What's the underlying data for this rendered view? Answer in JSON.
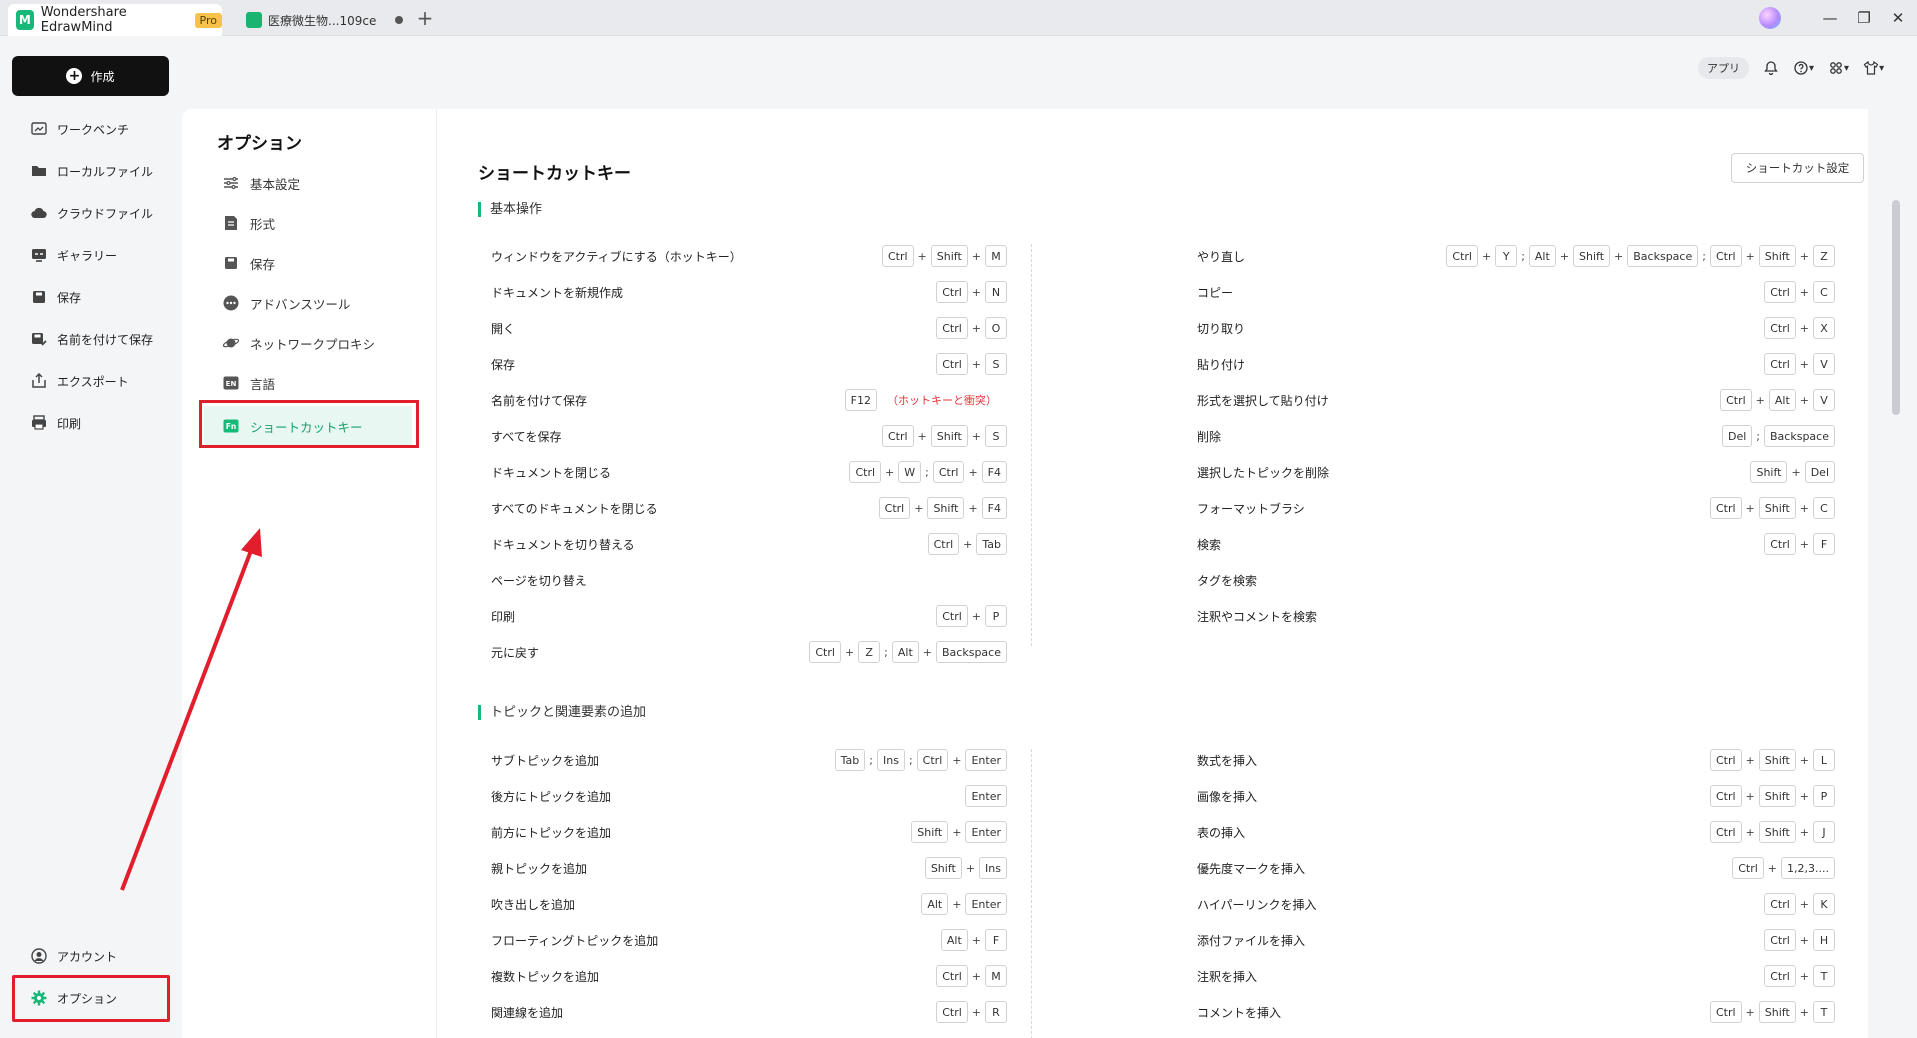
{
  "titlebar": {
    "app_name": "Wondershare EdrawMind",
    "pro_badge": "Pro",
    "doc_tab": "医療微生物...109ce",
    "new_tab": "+",
    "minimize": "—",
    "restore": "❐",
    "close": "✕"
  },
  "toolbar": {
    "apps": "アプリ"
  },
  "sidebar": {
    "create": "作成",
    "items": [
      "ワークベンチ",
      "ローカルファイル",
      "クラウドファイル",
      "ギャラリー",
      "保存",
      "名前を付けて保存",
      "エクスポート",
      "印刷"
    ],
    "account": "アカウント",
    "options": "オプション"
  },
  "options_nav": {
    "title": "オプション",
    "items": [
      "基本設定",
      "形式",
      "保存",
      "アドバンスツール",
      "ネットワークプロキシ",
      "言語",
      "ショートカットキー"
    ]
  },
  "main": {
    "title": "ショートカットキー",
    "settings_button": "ショートカット設定",
    "section1": {
      "title": "基本操作",
      "left": [
        {
          "label": "ウィンドウをアクティブにする（ホットキー）",
          "keys": [
            [
              "Ctrl",
              "Shift",
              "M"
            ]
          ]
        },
        {
          "label": "ドキュメントを新規作成",
          "keys": [
            [
              "Ctrl",
              "N"
            ]
          ]
        },
        {
          "label": "開く",
          "keys": [
            [
              "Ctrl",
              "O"
            ]
          ]
        },
        {
          "label": "保存",
          "keys": [
            [
              "Ctrl",
              "S"
            ]
          ]
        },
        {
          "label": "名前を付けて保存",
          "keys": [
            [
              "F12"
            ]
          ],
          "note": "（ホットキーと衝突）"
        },
        {
          "label": "すべてを保存",
          "keys": [
            [
              "Ctrl",
              "Shift",
              "S"
            ]
          ]
        },
        {
          "label": "ドキュメントを閉じる",
          "keys": [
            [
              "Ctrl",
              "W"
            ],
            [
              "Ctrl",
              "F4"
            ]
          ]
        },
        {
          "label": "すべてのドキュメントを閉じる",
          "keys": [
            [
              "Ctrl",
              "Shift",
              "F4"
            ]
          ]
        },
        {
          "label": "ドキュメントを切り替える",
          "keys": [
            [
              "Ctrl",
              "Tab"
            ]
          ]
        },
        {
          "label": "ページを切り替え",
          "keys": []
        },
        {
          "label": "印刷",
          "keys": [
            [
              "Ctrl",
              "P"
            ]
          ]
        },
        {
          "label": "元に戻す",
          "keys": [
            [
              "Ctrl",
              "Z"
            ],
            [
              "Alt",
              "Backspace"
            ]
          ]
        }
      ],
      "right": [
        {
          "label": "やり直し",
          "keys": [
            [
              "Ctrl",
              "Y"
            ],
            [
              "Alt",
              "Shift",
              "Backspace"
            ],
            [
              "Ctrl",
              "Shift",
              "Z"
            ]
          ]
        },
        {
          "label": "コピー",
          "keys": [
            [
              "Ctrl",
              "C"
            ]
          ]
        },
        {
          "label": "切り取り",
          "keys": [
            [
              "Ctrl",
              "X"
            ]
          ]
        },
        {
          "label": "貼り付け",
          "keys": [
            [
              "Ctrl",
              "V"
            ]
          ]
        },
        {
          "label": "形式を選択して貼り付け",
          "keys": [
            [
              "Ctrl",
              "Alt",
              "V"
            ]
          ]
        },
        {
          "label": "削除",
          "keys": [
            [
              "Del"
            ],
            [
              "Backspace"
            ]
          ]
        },
        {
          "label": "選択したトピックを削除",
          "keys": [
            [
              "Shift",
              "Del"
            ]
          ]
        },
        {
          "label": "フォーマットブラシ",
          "keys": [
            [
              "Ctrl",
              "Shift",
              "C"
            ]
          ]
        },
        {
          "label": "検索",
          "keys": [
            [
              "Ctrl",
              "F"
            ]
          ]
        },
        {
          "label": "タグを検索",
          "keys": []
        },
        {
          "label": "注釈やコメントを検索",
          "keys": []
        }
      ]
    },
    "section2": {
      "title": "トピックと関連要素の追加",
      "left": [
        {
          "label": "サブトピックを追加",
          "keys": [
            [
              "Tab"
            ],
            [
              "Ins"
            ],
            [
              "Ctrl",
              "Enter"
            ]
          ]
        },
        {
          "label": "後方にトピックを追加",
          "keys": [
            [
              "Enter"
            ]
          ]
        },
        {
          "label": "前方にトピックを追加",
          "keys": [
            [
              "Shift",
              "Enter"
            ]
          ]
        },
        {
          "label": "親トピックを追加",
          "keys": [
            [
              "Shift",
              "Ins"
            ]
          ]
        },
        {
          "label": "吹き出しを追加",
          "keys": [
            [
              "Alt",
              "Enter"
            ]
          ]
        },
        {
          "label": "フローティングトピックを追加",
          "keys": [
            [
              "Alt",
              "F"
            ]
          ]
        },
        {
          "label": "複数トピックを追加",
          "keys": [
            [
              "Ctrl",
              "M"
            ]
          ]
        },
        {
          "label": "関連線を追加",
          "keys": [
            [
              "Ctrl",
              "R"
            ]
          ]
        }
      ],
      "right": [
        {
          "label": "数式を挿入",
          "keys": [
            [
              "Ctrl",
              "Shift",
              "L"
            ]
          ]
        },
        {
          "label": "画像を挿入",
          "keys": [
            [
              "Ctrl",
              "Shift",
              "P"
            ]
          ]
        },
        {
          "label": "表の挿入",
          "keys": [
            [
              "Ctrl",
              "Shift",
              "J"
            ]
          ]
        },
        {
          "label": "優先度マークを挿入",
          "keys": [
            [
              "Ctrl",
              "1,2,3...."
            ]
          ]
        },
        {
          "label": "ハイパーリンクを挿入",
          "keys": [
            [
              "Ctrl",
              "K"
            ]
          ]
        },
        {
          "label": "添付ファイルを挿入",
          "keys": [
            [
              "Ctrl",
              "H"
            ]
          ]
        },
        {
          "label": "注釈を挿入",
          "keys": [
            [
              "Ctrl",
              "T"
            ]
          ]
        },
        {
          "label": "コメントを挿入",
          "keys": [
            [
              "Ctrl",
              "Shift",
              "T"
            ]
          ]
        }
      ]
    }
  },
  "colors": {
    "accent": "#17b978",
    "highlight": "#e21d2c",
    "warn": "#e8333a"
  }
}
